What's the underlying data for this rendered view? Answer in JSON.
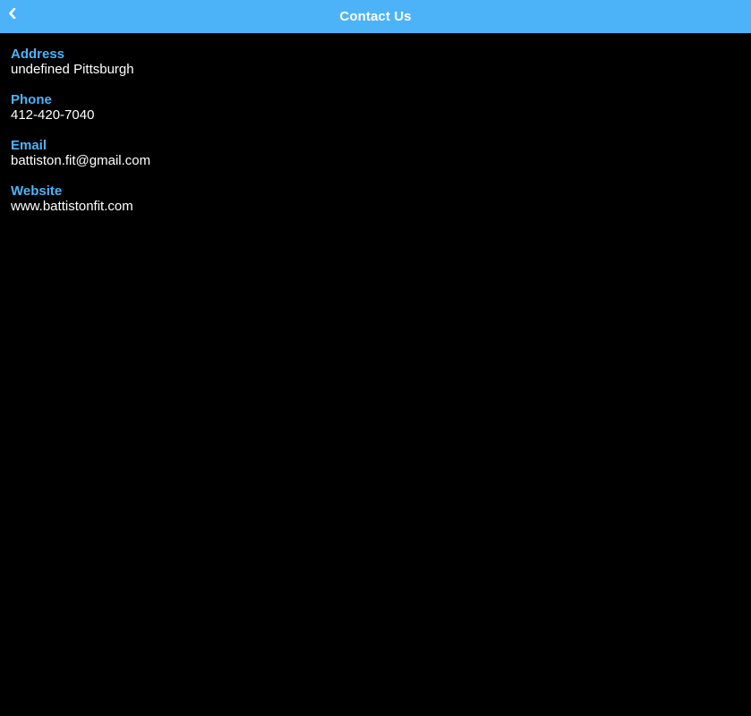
{
  "header": {
    "title": "Contact Us",
    "back_icon": "chevron-left-icon",
    "color": "#4db3f8"
  },
  "contact": {
    "address_label": "Address",
    "address_value": "undefined Pittsburgh",
    "phone_label": "Phone",
    "phone_value": "412-420-7040",
    "email_label": "Email",
    "email_value": "battiston.fit@gmail.com",
    "website_label": "Website",
    "website_value": "www.battistonfit.com"
  }
}
